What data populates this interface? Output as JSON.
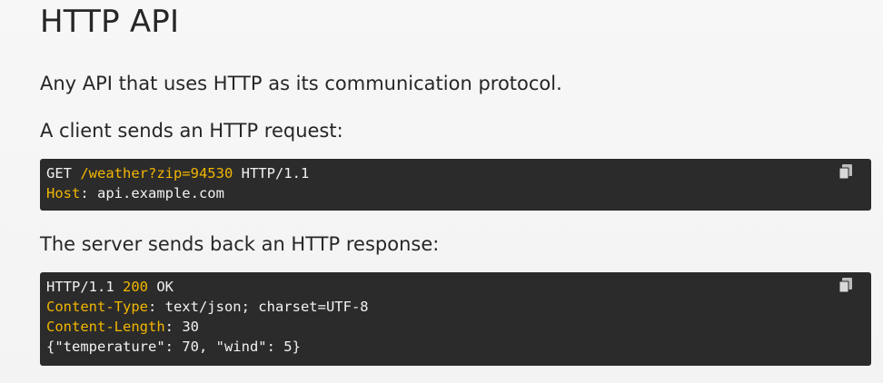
{
  "doc": {
    "title": "HTTP API",
    "para1": "Any API that uses HTTP as its communication protocol.",
    "para2": "A client sends an HTTP request:",
    "para3": "The server sends back an HTTP response:"
  },
  "request_code": {
    "line1": {
      "method": "GET ",
      "path": "/weather?zip=94530",
      "version": " HTTP/1.1"
    },
    "line2": {
      "key": "Host",
      "rest": ": api.example.com"
    }
  },
  "response_code": {
    "line1": {
      "version": "HTTP/1.1 ",
      "status": "200",
      "reason": " OK"
    },
    "line2": {
      "key": "Content-Type",
      "rest": ": text/json; charset=UTF-8"
    },
    "line3": {
      "key": "Content-Length",
      "rest": ": 30"
    },
    "line4": {
      "body": "{\"temperature\": 70, \"wind\": 5}"
    }
  },
  "icons": {
    "copy": "copy-icon"
  },
  "colors": {
    "code_bg": "#2b2b2b",
    "code_text": "#f2f2f2",
    "highlight": "#f2b600"
  }
}
